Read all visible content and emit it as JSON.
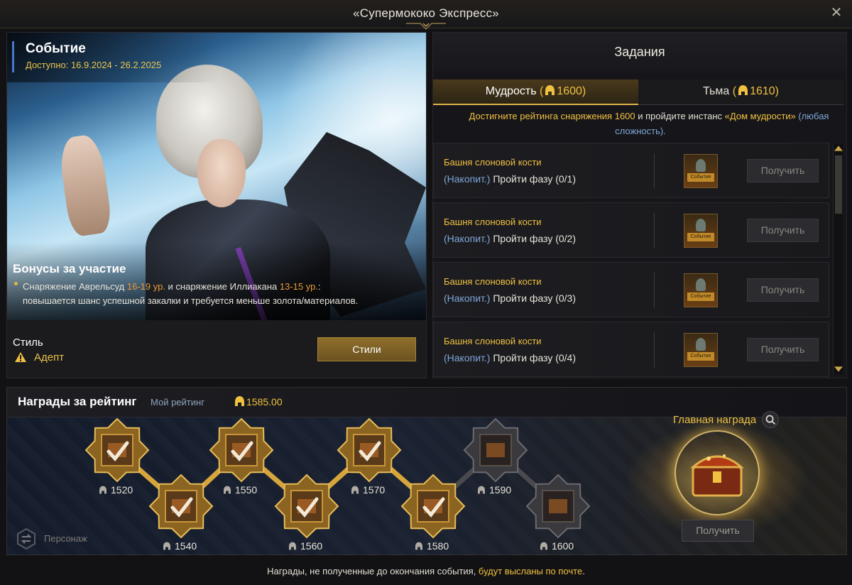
{
  "window": {
    "title": "«Супермококо Экспресс»"
  },
  "event": {
    "title": "Событие",
    "dates": "Доступно: 16.9.2024 - 26.2.2025",
    "bonus_title": "Бонусы за участие",
    "bonus_line1_a": "Снаряжение Аврельсуд ",
    "bonus_line1_b": "16-19 ур.",
    "bonus_line1_c": " и снаряжение Иллиакана ",
    "bonus_line1_d": "13-15 ур.",
    "bonus_line1_e": ":",
    "bonus_line2": "повышается шанс успешной закалки и требуется меньше золота/материалов.",
    "style_label": "Стиль",
    "style_value": "Адепт",
    "styles_button": "Стили"
  },
  "tasks": {
    "title": "Задания",
    "tabs": [
      {
        "label": "Мудрость",
        "value": "1600",
        "active": true
      },
      {
        "label": "Тьма",
        "value": "1610",
        "active": false
      }
    ],
    "desc_a": "Достигните рейтинга снаряжения 1600",
    "desc_b": " и пройдите инстанс ",
    "desc_c": "«Дом мудрости»",
    "desc_d": " (любая",
    "desc_e": "сложность).",
    "rows": [
      {
        "name": "Башня слоновой кости",
        "tag": "(Накопит.)",
        "progress": "Пройти фазу (0/1)",
        "reward_badge": "Событие",
        "button": "Получить"
      },
      {
        "name": "Башня слоновой кости",
        "tag": "(Накопит.)",
        "progress": "Пройти фазу (0/2)",
        "reward_badge": "Событие",
        "button": "Получить"
      },
      {
        "name": "Башня слоновой кости",
        "tag": "(Накопит.)",
        "progress": "Пройти фазу (0/3)",
        "reward_badge": "Событие",
        "button": "Получить"
      },
      {
        "name": "Башня слоновой кости",
        "tag": "(Накопит.)",
        "progress": "Пройти фазу (0/4)",
        "reward_badge": "Событие",
        "button": "Получить"
      }
    ]
  },
  "ranking": {
    "title": "Награды за рейтинг",
    "my_label": "Мой рейтинг",
    "my_value": "1585.00",
    "nodes": [
      {
        "value": "1520",
        "claimed": true
      },
      {
        "value": "1540",
        "claimed": true
      },
      {
        "value": "1550",
        "claimed": true
      },
      {
        "value": "1560",
        "claimed": true
      },
      {
        "value": "1570",
        "claimed": true
      },
      {
        "value": "1580",
        "claimed": true
      },
      {
        "value": "1590",
        "claimed": false
      },
      {
        "value": "1600",
        "claimed": false
      }
    ],
    "grand_title": "Главная награда",
    "grand_button": "Получить",
    "persona_label": "Персонаж"
  },
  "footer": {
    "note_a": "Награды, не полученные до окончания события, ",
    "note_b": "будут высланы по почте",
    "note_c": "."
  },
  "colors": {
    "accent_gold": "#f0c040",
    "link_blue": "#7ea4d6",
    "orange": "#e89a3a"
  }
}
